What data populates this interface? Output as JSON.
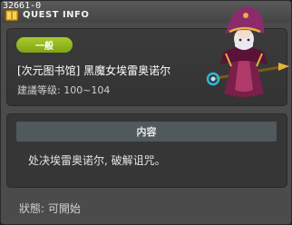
{
  "header": {
    "quest_id": "32661-0",
    "title": "QUEST INFO"
  },
  "quest": {
    "category": "一般",
    "name": "[次元图书馆] 黑魔女埃雷奥诺尔",
    "level_range": "建議等级: 100~104"
  },
  "content": {
    "header": "内容",
    "description": "处决埃雷奥诺尔, 破解诅咒。"
  },
  "status": "狀態: 可開始",
  "icons": [
    "quest-book-icon",
    "npc-dark-witch"
  ],
  "colors": {
    "category_pill": "#9ac020",
    "content_header": "#50595c",
    "background": "#4b4b4b"
  }
}
